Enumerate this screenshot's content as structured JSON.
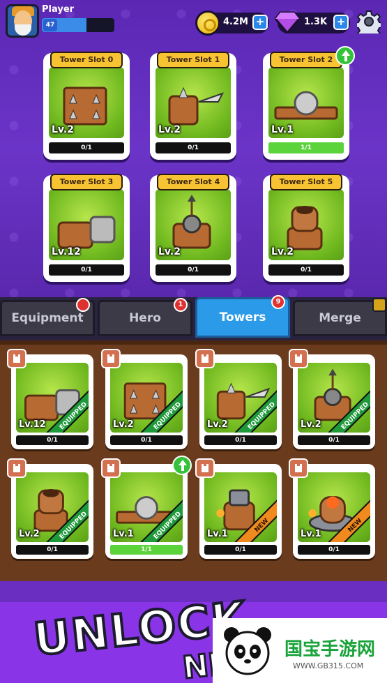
{
  "header": {
    "player_name": "Player",
    "level": "47",
    "xp_fraction": 0.62,
    "gold": "4.2M",
    "gems": "1.3K",
    "plus_label": "+"
  },
  "tower_slots": [
    {
      "label": "Tower Slot 0",
      "level": "Lv.2",
      "progress": "0/1",
      "fill": 0
    },
    {
      "label": "Tower Slot 1",
      "level": "Lv.2",
      "progress": "0/1",
      "fill": 0
    },
    {
      "label": "Tower Slot 2",
      "level": "Lv.1",
      "progress": "1/1",
      "fill": 1,
      "upgrade": true
    },
    {
      "label": "Tower Slot 3",
      "level": "Lv.12",
      "progress": "0/1",
      "fill": 0
    },
    {
      "label": "Tower Slot 4",
      "level": "Lv.2",
      "progress": "0/1",
      "fill": 0
    },
    {
      "label": "Tower Slot 5",
      "level": "Lv.2",
      "progress": "0/1",
      "fill": 0
    }
  ],
  "tabs": [
    {
      "label": "Equipment",
      "badge": ""
    },
    {
      "label": "Hero",
      "badge": "1"
    },
    {
      "label": "Towers",
      "badge": "9"
    },
    {
      "label": "Merge",
      "badge": ""
    }
  ],
  "inventory": [
    {
      "level": "Lv.12",
      "progress": "0/1",
      "ribbon": "EQUIPPED",
      "fill": 0
    },
    {
      "level": "Lv.2",
      "progress": "0/1",
      "ribbon": "EQUIPPED",
      "fill": 0
    },
    {
      "level": "Lv.2",
      "progress": "0/1",
      "ribbon": "EQUIPPED",
      "fill": 0
    },
    {
      "level": "Lv.2",
      "progress": "0/1",
      "ribbon": "EQUIPPED",
      "fill": 0
    },
    {
      "level": "Lv.2",
      "progress": "0/1",
      "ribbon": "EQUIPPED",
      "fill": 0
    },
    {
      "level": "Lv.1",
      "progress": "1/1",
      "ribbon": "EQUIPPED",
      "fill": 1,
      "upgrade": true
    },
    {
      "level": "Lv.1",
      "progress": "0/1",
      "ribbon": "NEW",
      "fill": 0
    },
    {
      "level": "Lv.1",
      "progress": "0/1",
      "ribbon": "NEW",
      "fill": 0
    }
  ],
  "banner": {
    "line1": "UNLOCK",
    "line2": "NE"
  },
  "watermark": {
    "title": "国宝手游网",
    "url": "WWW.GB315.COM"
  },
  "colors": {
    "background": "#6a2fc0",
    "tab_active": "#2b9ae8",
    "slot_label": "#f7c332",
    "equipped": "#1f9a3b",
    "new": "#f08a1e",
    "inventory_bg": "#6b3b1e"
  }
}
